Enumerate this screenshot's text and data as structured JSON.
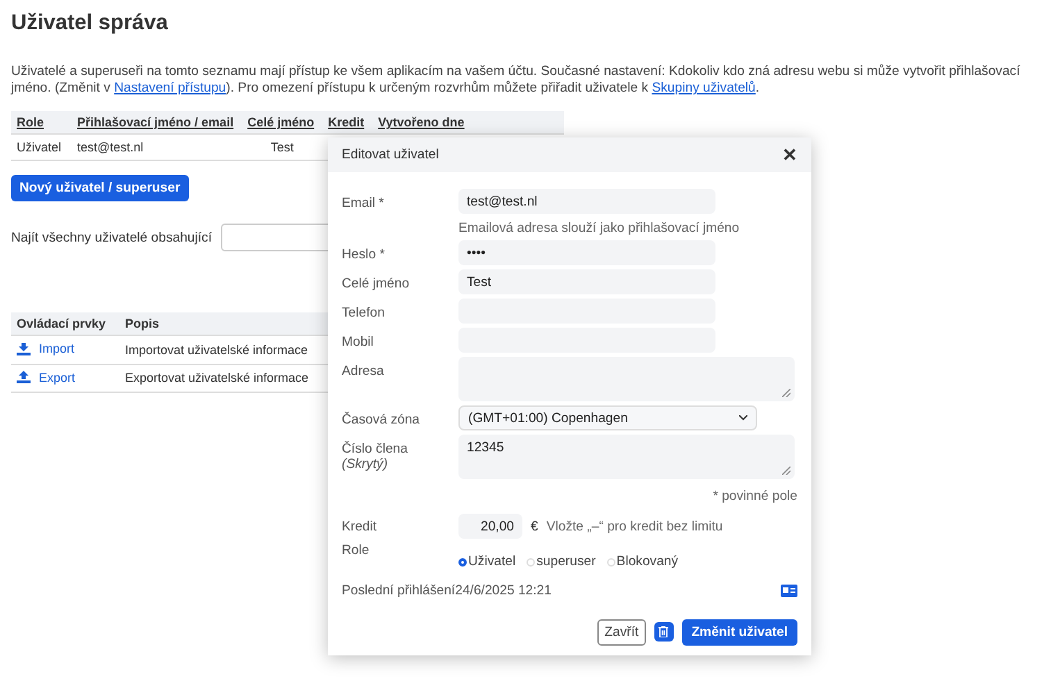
{
  "title": "Uživatel správa",
  "intro": {
    "before": "Uživatelé a superuseři na tomto seznamu mají přístup ke všem aplikacím na vašem účtu. Současné nastavení: Kdokoliv kdo zná adresu webu si může vytvořit přihlašovací jméno. (Změnit v ",
    "link1": "Nastavení přístupu",
    "middle": "). Pro omezení přístupu k určeným rozvrhům můžete přiřadit uživatele k ",
    "link2": "Skupiny uživatelů",
    "after": "."
  },
  "users_table": {
    "columns": [
      "Role",
      "Přihlašovací jméno / email",
      "Celé jméno",
      "Kredit",
      "Vytvořeno dne"
    ],
    "rows": [
      [
        "Uživatel",
        "test@test.nl",
        "Test"
      ]
    ]
  },
  "new_user_button": "Nový uživatel / superuser",
  "search": {
    "label": "Najít všechny uživatelé obsahující"
  },
  "controls_table": {
    "columns": [
      "Ovládací prvky",
      "Popis"
    ],
    "rows": [
      {
        "kind": "import",
        "label": "Import",
        "description": "Importovat uživatelské informace"
      },
      {
        "kind": "export",
        "label": "Export",
        "description": "Exportovat uživatelské informace"
      }
    ]
  },
  "dialog": {
    "title": "Editovat uživatel",
    "close": "✕",
    "fields": [
      {
        "kind": "input",
        "label": "Email *",
        "value": "test@test.nl",
        "hint": "Emailová adresa slouží jako přihlašovací jméno"
      },
      {
        "kind": "input",
        "label": "Heslo *",
        "value": "••••"
      },
      {
        "kind": "input",
        "label": "Celé jméno",
        "value": "Test"
      },
      {
        "kind": "input",
        "label": "Telefon"
      },
      {
        "kind": "input",
        "label": "Mobil"
      },
      {
        "kind": "textarea",
        "label": "Adresa"
      },
      {
        "kind": "select",
        "label": "Časová zóna",
        "value": "(GMT+01:00) Copenhagen"
      },
      {
        "kind": "textarea",
        "label": "Číslo člena",
        "sublabel": "(Skrytý)",
        "value": "12345"
      }
    ],
    "required_note": "* povinné pole",
    "credit": {
      "label": "Kredit",
      "value": "20,00",
      "currency": "€",
      "note": "Vložte „–“ pro kredit bez limitu"
    },
    "role": {
      "label": "Role",
      "options": [
        {
          "label": "Uživatel",
          "selected": true
        },
        {
          "label": "superuser",
          "selected": false
        },
        {
          "label": "Blokovaný",
          "selected": false
        }
      ]
    },
    "last_login": {
      "label": "Poslední přihlášení",
      "value": "24/6/2025 12:21"
    },
    "buttons": {
      "close": "Zavřít",
      "submit": "Změnit uživatel"
    }
  }
}
